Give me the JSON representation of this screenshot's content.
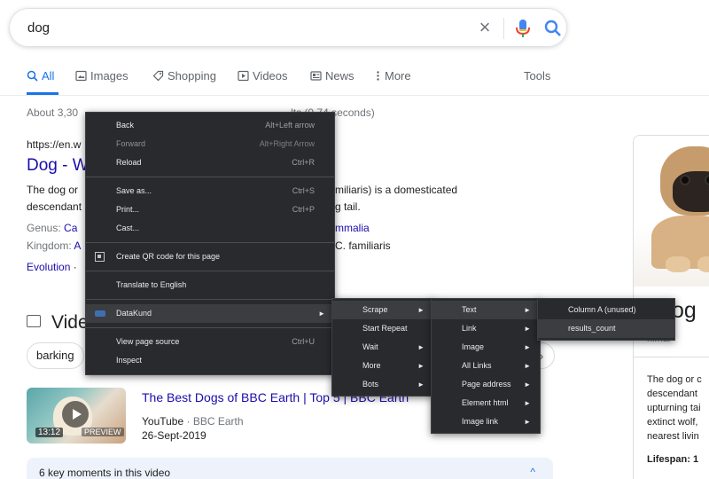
{
  "search": {
    "query": "dog",
    "clear_glyph": "×",
    "mic_icon": "microphone-icon",
    "lens_icon": "search-icon"
  },
  "tabs": [
    {
      "label": "All",
      "icon": "search-icon",
      "active": true
    },
    {
      "label": "Images",
      "icon": "image-icon"
    },
    {
      "label": "Shopping",
      "icon": "tag-icon"
    },
    {
      "label": "Videos",
      "icon": "video-icon"
    },
    {
      "label": "News",
      "icon": "news-icon"
    },
    {
      "label": "More",
      "icon": "more-vert-icon"
    },
    {
      "label": "Tools"
    }
  ],
  "results": {
    "stats": "About 3,30",
    "stats_tail": "lts (0.74 seconds)",
    "url": "https://en.w",
    "title": "Dog - W",
    "snippet_l1": "The dog or",
    "snippet_l1_r": "miliaris) is a domesticated",
    "snippet_l2": "descendant",
    "snippet_l2_r": "g tail.",
    "genus_label": "Genus:",
    "genus_value": "Ca",
    "genus_r": "mmalia",
    "kingdom_label": "Kingdom:",
    "kingdom_value": "A",
    "kingdom_r": "C. familiaris",
    "evolution_link": "Evolution",
    "evolution_sep": " ·"
  },
  "videos": {
    "heading": "Vide",
    "chip": "barking",
    "chip_arrow": "›",
    "thumb_duration": "13:12",
    "thumb_preview": "PREVIEW",
    "title": "The Best Dogs of BBC Earth | Top 5 | BBC Earth",
    "source": "YouTube",
    "channel": " · BBC Earth",
    "date": "26-Sept-2019",
    "moments": "6 key moments in this video",
    "moments_caret": "^"
  },
  "knowledge_panel": {
    "heading": "og",
    "subtitle": "nimal",
    "desc_lines": [
      "The dog or c",
      "descendant",
      "upturning tai",
      "extinct wolf,",
      "nearest livin"
    ],
    "footer": "Lifespan: 1"
  },
  "context_menu": {
    "items": [
      {
        "label": "Back",
        "shortcut": "Alt+Left arrow"
      },
      {
        "label": "Forward",
        "shortcut": "Alt+Right Arrow",
        "disabled": true
      },
      {
        "label": "Reload",
        "shortcut": "Ctrl+R"
      },
      {
        "label": "Save as...",
        "shortcut": "Ctrl+S"
      },
      {
        "label": "Print...",
        "shortcut": "Ctrl+P"
      },
      {
        "label": "Cast..."
      },
      {
        "label": "Create QR code for this page",
        "icon": "qr-code-icon"
      },
      {
        "label": "Translate to English"
      },
      {
        "label": "DataKund",
        "icon": "datakund-icon",
        "submenu": true
      },
      {
        "label": "View page source",
        "shortcut": "Ctrl+U"
      },
      {
        "label": "Inspect"
      }
    ]
  },
  "datakund_menu": {
    "items": [
      {
        "label": "Scrape",
        "submenu": true
      },
      {
        "label": "Start Repeat"
      },
      {
        "label": "Wait",
        "submenu": true
      },
      {
        "label": "More",
        "submenu": true
      },
      {
        "label": "Bots",
        "submenu": true
      }
    ]
  },
  "scrape_menu": {
    "items": [
      {
        "label": "Text",
        "submenu": true
      },
      {
        "label": "Link",
        "submenu": true
      },
      {
        "label": "Image",
        "submenu": true
      },
      {
        "label": "All Links",
        "submenu": true
      },
      {
        "label": "Page address",
        "submenu": true
      },
      {
        "label": "Element html",
        "submenu": true
      },
      {
        "label": "Image link",
        "submenu": true
      }
    ]
  },
  "text_menu": {
    "items": [
      {
        "label": "Column A  (unused)"
      },
      {
        "label": "results_count"
      }
    ]
  },
  "submenu_arrow": "►",
  "colors": {
    "link": "#1a0dab",
    "accent": "#1a73e8",
    "menu_bg": "#292a2d",
    "menu_highlight": "#3c3d41"
  }
}
